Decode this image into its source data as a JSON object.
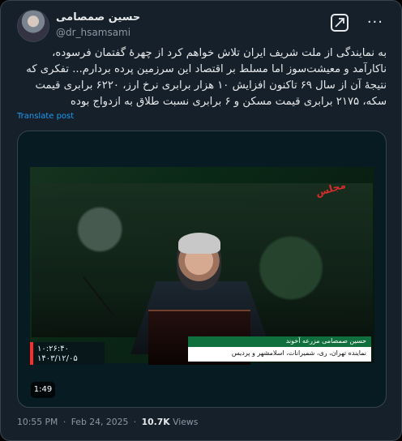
{
  "author": {
    "name": "حسین صمصامی",
    "handle": "@dr_hsamsami",
    "avatar_icon": "user-avatar-icon"
  },
  "header": {
    "grok_icon": "grok-icon",
    "more_icon": "more-icon",
    "more_label": "···"
  },
  "tweet": {
    "text": "به نمایندگی از ملت شریف ایران تلاش خواهم کرد از چهرهٔ گفتمان فرسوده، ناکارآمد و معیشت‌سوز اما مسلط بر  اقتصاد این سرزمین پرده بردارم... تفکری که نتیجهٔ آن از سال ۶۹ تاکنون افزایش ۱۰ هزار برابری نرخ ارز، ۶۲۲۰ برابری قیمت سکه، ۲۱۷۵ برابری قیمت مسکن و ۶ برابری نسبت طلاق به ازدواج بوده",
    "translate_label": "Translate post"
  },
  "media": {
    "video_logo": "مجلس",
    "timestamp_line1": "۱۰:۲۶:۴۰",
    "timestamp_line2": "۱۴۰۳/۱۲/۰۵",
    "caption_name": "حسین صمصامی مزرعه آخوند",
    "caption_role": "نماینده تهران، ری، شمیرانات، اسلامشهر و پردیس",
    "duration": "1:49"
  },
  "footer": {
    "time": "10:55 PM",
    "date": "Feb 24, 2025",
    "views_count": "10.7K",
    "views_label": "Views"
  },
  "colors": {
    "background": "#15202b",
    "accent": "#1d9bf0",
    "text": "#e7e9ea",
    "muted": "#8b98a5"
  }
}
